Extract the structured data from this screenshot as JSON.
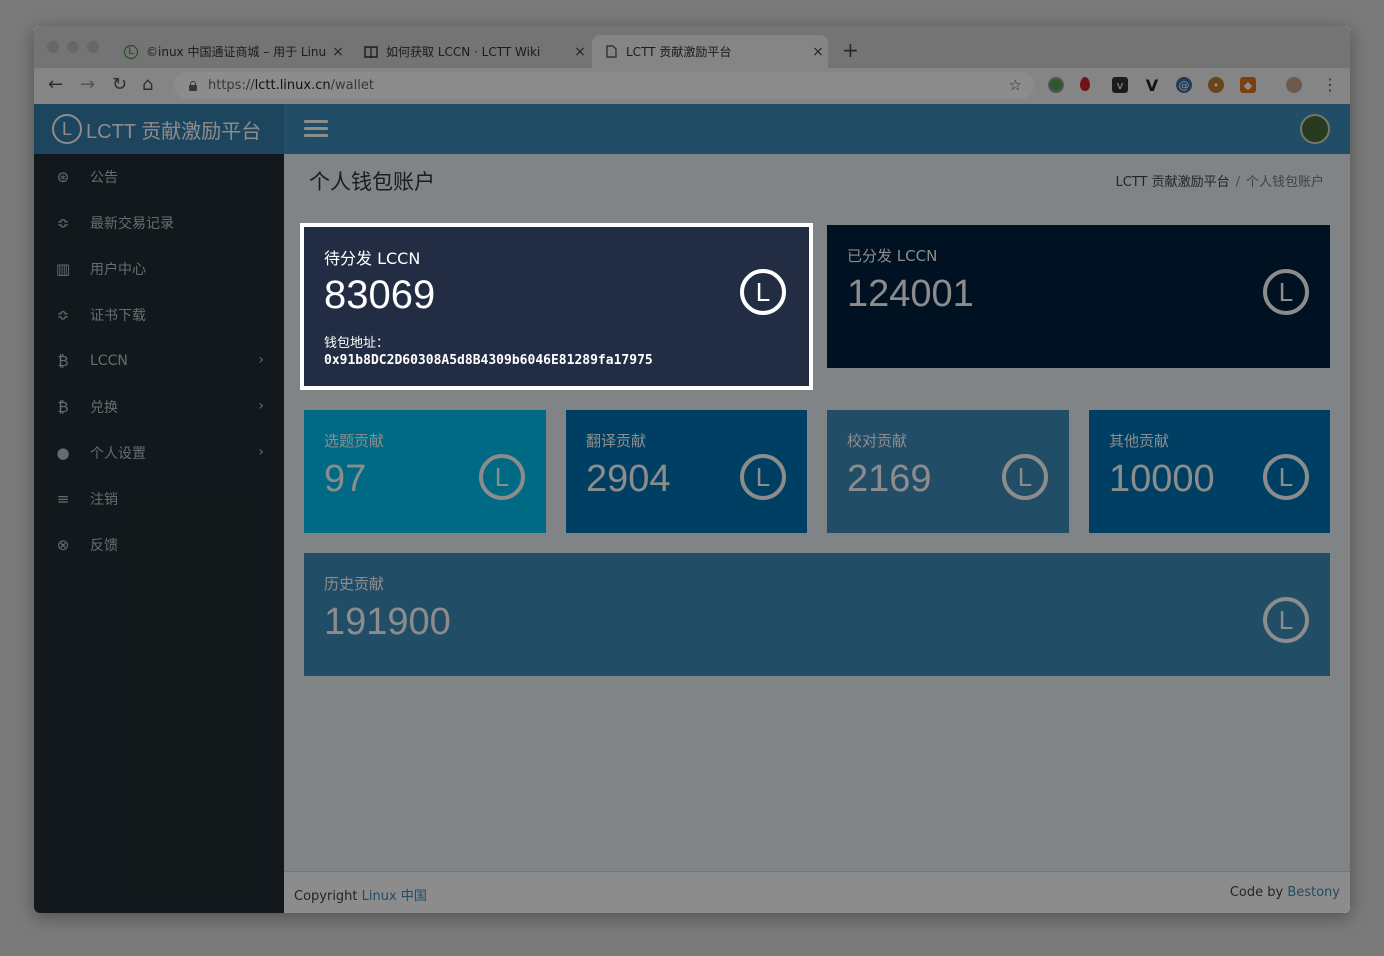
{
  "browser": {
    "tabs": [
      {
        "title": "©inux 中国通证商城 – 用于 Linu",
        "icon": "L"
      },
      {
        "title": "如何获取 LCCN · LCTT Wiki",
        "icon": "book"
      },
      {
        "title": "LCTT 贡献激励平台",
        "icon": "doc"
      }
    ],
    "url_prefix": "https://",
    "url_host": "lctt.linux.cn",
    "url_path": "/wallet"
  },
  "header": {
    "logo_letter": "L",
    "app_title": "LCTT 贡献激励平台"
  },
  "sidebar": {
    "items": [
      {
        "label": "公告",
        "icon": "life-ring-icon",
        "glyph": "⊛",
        "has_children": false
      },
      {
        "label": "最新交易记录",
        "icon": "exchange-icon",
        "glyph": "≎",
        "has_children": false
      },
      {
        "label": "用户中心",
        "icon": "bar-chart-icon",
        "glyph": "▥",
        "has_children": false
      },
      {
        "label": "证书下载",
        "icon": "certificate-icon",
        "glyph": "≎",
        "has_children": false
      },
      {
        "label": "LCCN",
        "icon": "bitcoin-icon",
        "glyph": "₿",
        "has_children": true
      },
      {
        "label": "兑换",
        "icon": "bitcoin-icon",
        "glyph": "₿",
        "has_children": true
      },
      {
        "label": "个人设置",
        "icon": "user-icon",
        "glyph": "●",
        "has_children": true
      },
      {
        "label": "注销",
        "icon": "menu-icon",
        "glyph": "≡",
        "has_children": false
      },
      {
        "label": "反馈",
        "icon": "handshake-icon",
        "glyph": "⊗",
        "has_children": false
      }
    ],
    "chevron": "›"
  },
  "page": {
    "title": "个人钱包账户",
    "breadcrumb_home": "LCTT 贡献激励平台",
    "breadcrumb_sep": "/",
    "breadcrumb_current": "个人钱包账户"
  },
  "boxes": {
    "pending": {
      "label": "待分发 LCCN",
      "value": "83069",
      "wallet_label": "钱包地址：",
      "wallet_address": "0x91b8DC2D60308A5d8B4309b6046E81289fa17975"
    },
    "distributed": {
      "label": "已分发 LCCN",
      "value": "124001"
    },
    "topic": {
      "label": "选题贡献",
      "value": "97"
    },
    "translate": {
      "label": "翻译贡献",
      "value": "2904"
    },
    "proofread": {
      "label": "校对贡献",
      "value": "2169"
    },
    "other": {
      "label": "其他贡献",
      "value": "10000"
    },
    "history": {
      "label": "历史贡献",
      "value": "191900"
    },
    "coin_letter": "L"
  },
  "footer": {
    "copyright": "Copyright",
    "copyright_link": "Linux 中国",
    "code_by": "Code by",
    "code_by_link": "Bestony"
  },
  "colors": {
    "primary": "#3c8dbc",
    "sidebar": "#222d32",
    "box_aqua": "#00c0ef",
    "box_blue": "#0073b7",
    "box_lightblue": "#3c8dbc",
    "box_navy": "#001f3f"
  }
}
